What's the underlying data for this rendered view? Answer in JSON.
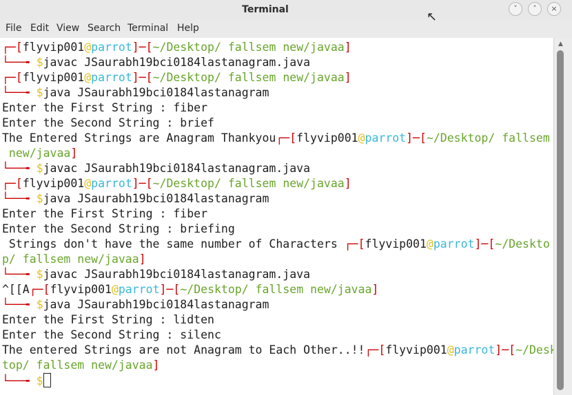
{
  "window": {
    "title": "Terminal",
    "minimize_icon": "˅",
    "maximize_icon": "˄",
    "close_icon": "×"
  },
  "menu": [
    "File",
    "Edit",
    "View",
    "Search",
    "Terminal",
    "Help"
  ],
  "prompt": {
    "user": "flyvip001",
    "at": "@",
    "host": "parrot",
    "dir": "~/Desktop/ fallsem new/javaa",
    "dir_part1": "~/Desk",
    "dir_part2": "top/ fallsem new/javaa",
    "dir_part1b": "~/Deskto",
    "dir_part2b": "p/ fallsem new/javaa",
    "dir_part1c": "~/Desktop/ fallsem",
    "dir_part2c": " new/javaa"
  },
  "commands": {
    "compile": "javac JSaurabh19bci0184lastanagram.java",
    "run": "java JSaurabh19bci0184lastanagram"
  },
  "output": {
    "first_prompt": "Enter the First String : ",
    "second_prompt": "Enter the Second String : ",
    "run1_first": "fiber",
    "run1_second": "brief",
    "run1_result": "The Entered Strings are Anagram Thankyou",
    "run2_first": "fiber",
    "run2_second": "briefing",
    "run2_result": " Strings don't have the same number of Characters ",
    "escape_seq": "^[[A",
    "run3_first": "lidten",
    "run3_second": "silenc",
    "run3_result": "The entered Strings are not Anagram to Each Other..!!"
  },
  "colors": {
    "prompt_frame": "#cc0000",
    "host": "#37b8d9",
    "path": "#68a52b",
    "dollar": "#e0c020"
  }
}
